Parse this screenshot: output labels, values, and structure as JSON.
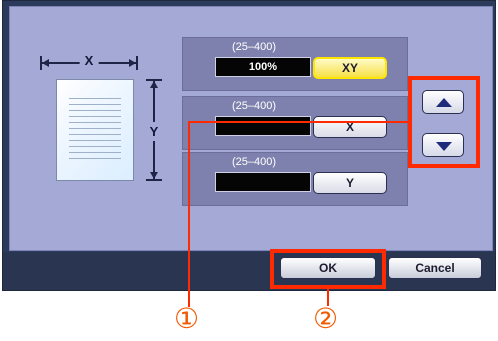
{
  "diagram": {
    "x_label": "X",
    "y_label": "Y"
  },
  "zoom_rows": [
    {
      "range": "(25–400)",
      "value": "100%",
      "button": "XY"
    },
    {
      "range": "(25–400)",
      "value": "",
      "button": "X"
    },
    {
      "range": "(25–400)",
      "value": "",
      "button": "Y"
    }
  ],
  "buttons": {
    "ok": "OK",
    "cancel": "Cancel"
  },
  "callouts": {
    "one": "①",
    "two": "②"
  },
  "colors": {
    "panel": "#a5a9d5",
    "frame": "#2c3a5c",
    "highlight": "#ff2a00",
    "selected_button": "#f6e047",
    "arrow": "#1e2b7a",
    "callout_text": "#f05a00"
  }
}
